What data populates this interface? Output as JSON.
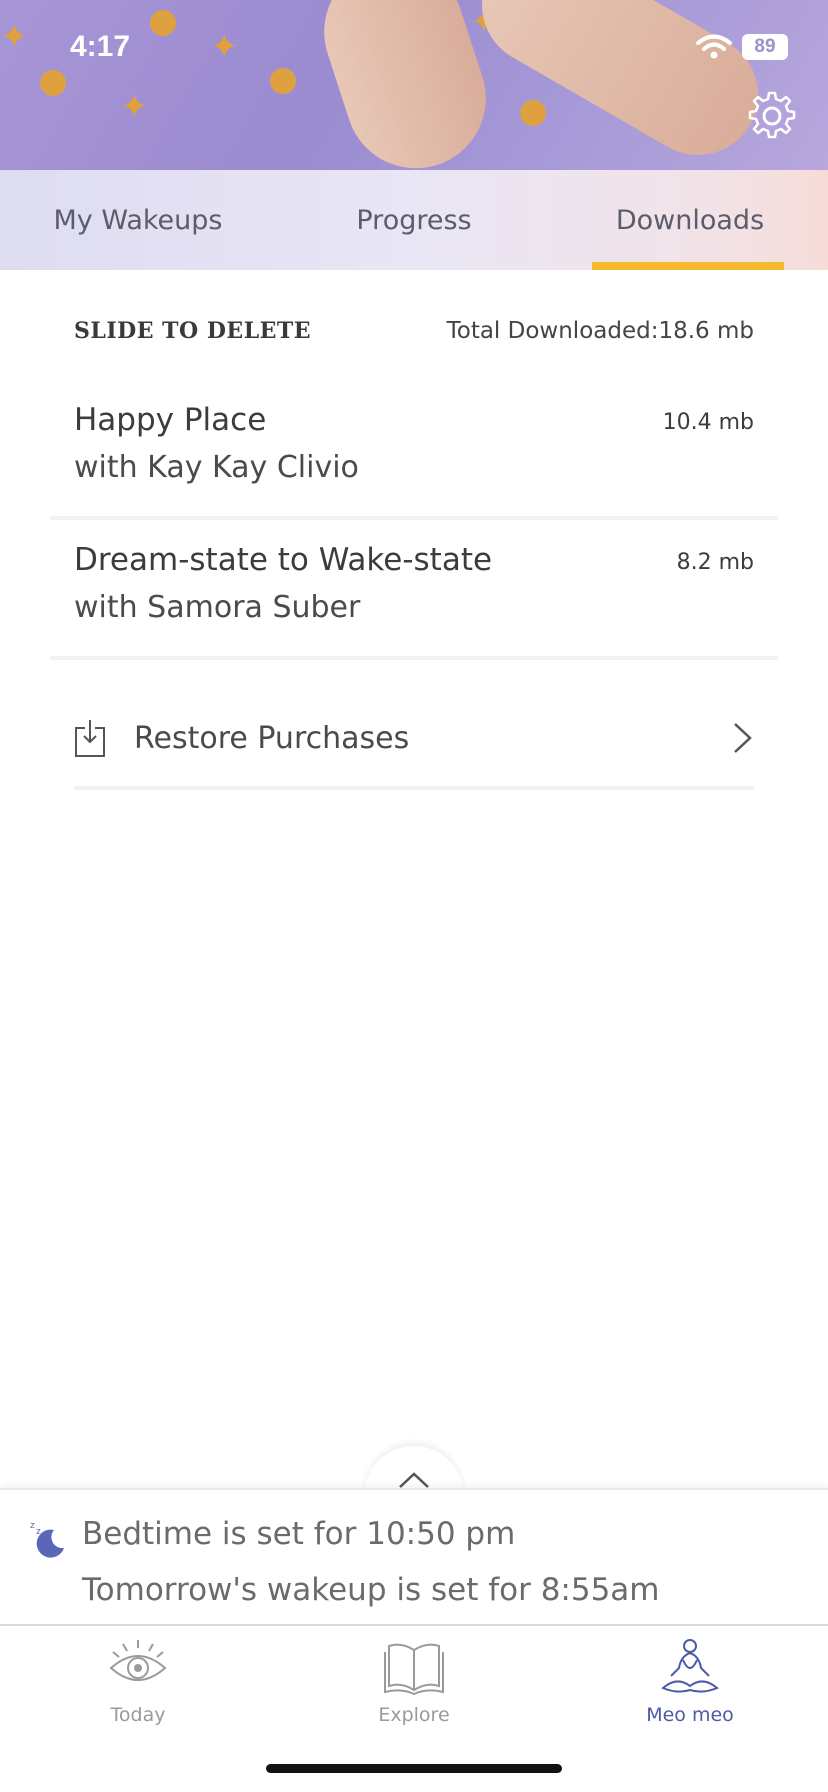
{
  "status_bar": {
    "time": "4:17",
    "battery": "89"
  },
  "header": {
    "settings_icon": "gear-icon"
  },
  "tabs": [
    {
      "label": "My Wakeups",
      "active": false
    },
    {
      "label": "Progress",
      "active": false
    },
    {
      "label": "Downloads",
      "active": true
    }
  ],
  "downloads": {
    "instruction": "SLIDE TO DELETE",
    "total_label": "Total Downloaded:",
    "total_value": "18.6 mb",
    "items": [
      {
        "title": "Happy Place",
        "subtitle": "with Kay Kay Clivio",
        "size": "10.4 mb"
      },
      {
        "title": "Dream-state to Wake-state",
        "subtitle": "with Samora Suber",
        "size": "8.2 mb"
      }
    ],
    "restore_label": "Restore Purchases"
  },
  "bedtime": {
    "line1": "Bedtime is set for 10:50 pm",
    "line2": "Tomorrow's wakeup is set for 8:55am"
  },
  "nav": [
    {
      "label": "Today",
      "icon": "eye-icon",
      "active": false
    },
    {
      "label": "Explore",
      "icon": "book-icon",
      "active": false
    },
    {
      "label": "Meo meo",
      "icon": "meditation-icon",
      "active": true
    }
  ],
  "colors": {
    "accent": "#f6b82d",
    "nav_active": "#4c5aa8"
  }
}
